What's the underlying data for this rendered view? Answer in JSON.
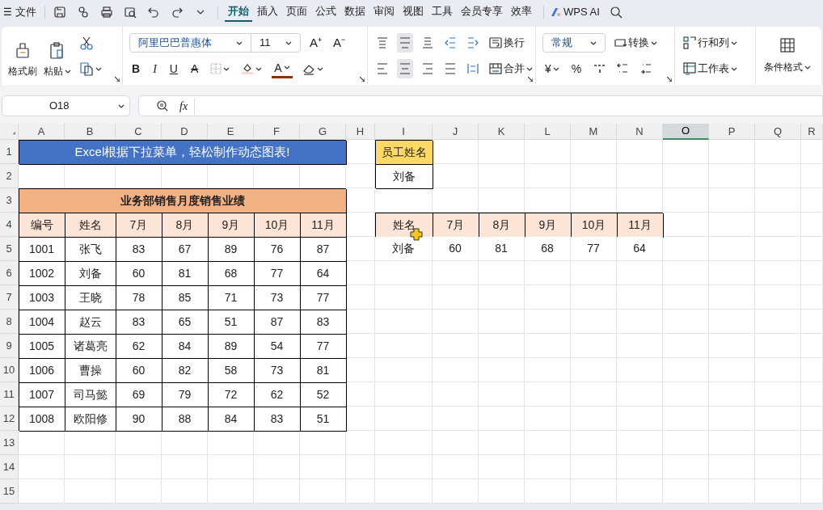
{
  "menu_bar": {
    "menu_glyph": "☰",
    "file": "文件",
    "tabs": [
      {
        "label": "开始",
        "selected": true
      },
      {
        "label": "插入",
        "selected": false
      },
      {
        "label": "页面",
        "selected": false
      },
      {
        "label": "公式",
        "selected": false
      },
      {
        "label": "数据",
        "selected": false
      },
      {
        "label": "审阅",
        "selected": false
      },
      {
        "label": "视图",
        "selected": false
      },
      {
        "label": "工具",
        "selected": false
      },
      {
        "label": "会员专享",
        "selected": false
      },
      {
        "label": "效率",
        "selected": false
      }
    ],
    "ai": "WPS AI"
  },
  "ribbon": {
    "format_painter": "格式刷",
    "paste": "粘贴",
    "font": "阿里巴巴普惠体",
    "size": "11",
    "grow": "A⁺",
    "shrink": "A⁻",
    "bold": "B",
    "italic": "I",
    "underline": "U",
    "strike": "A",
    "font_color": "A",
    "wrap": "换行",
    "merge": "合并",
    "number_format": "常规",
    "convert": "转换",
    "currency": "¥",
    "percent": "%",
    "rows_cols": "行和列",
    "worksheet": "工作表",
    "conditional": "条件格式"
  },
  "formula_bar": {
    "name_box": "O18",
    "fx": "fx"
  },
  "sheet": {
    "columns": [
      {
        "label": "A",
        "selected": false
      },
      {
        "label": "B",
        "selected": false
      },
      {
        "label": "C",
        "selected": false
      },
      {
        "label": "D",
        "selected": false
      },
      {
        "label": "E",
        "selected": false
      },
      {
        "label": "F",
        "selected": false
      },
      {
        "label": "G",
        "selected": false
      },
      {
        "label": "H",
        "selected": false
      },
      {
        "label": "I",
        "selected": false
      },
      {
        "label": "J",
        "selected": false
      },
      {
        "label": "K",
        "selected": false
      },
      {
        "label": "L",
        "selected": false
      },
      {
        "label": "M",
        "selected": false
      },
      {
        "label": "N",
        "selected": false
      },
      {
        "label": "O",
        "selected": true
      },
      {
        "label": "P",
        "selected": false
      },
      {
        "label": "Q",
        "selected": false
      },
      {
        "label": "R",
        "selected": false
      }
    ],
    "rows": [
      "1",
      "2",
      "3",
      "4",
      "5",
      "6",
      "7",
      "8",
      "9",
      "10",
      "11",
      "12",
      "13",
      "14",
      "15"
    ],
    "banner": "Excel根据下拉菜单，轻松制作动态图表!",
    "sales_table": {
      "title": "业务部销售月度销售业绩",
      "columns": [
        "编号",
        "姓名",
        "7月",
        "8月",
        "9月",
        "10月",
        "11月"
      ],
      "rows": [
        [
          "1001",
          "张飞",
          "83",
          "67",
          "89",
          "76",
          "87"
        ],
        [
          "1002",
          "刘备",
          "60",
          "81",
          "68",
          "77",
          "64"
        ],
        [
          "1003",
          "王晓",
          "78",
          "85",
          "71",
          "73",
          "77"
        ],
        [
          "1004",
          "赵云",
          "83",
          "65",
          "51",
          "87",
          "83"
        ],
        [
          "1005",
          "诸葛亮",
          "62",
          "84",
          "89",
          "54",
          "77"
        ],
        [
          "1006",
          "曹操",
          "60",
          "82",
          "58",
          "73",
          "81"
        ],
        [
          "1007",
          "司马懿",
          "69",
          "79",
          "72",
          "62",
          "52"
        ],
        [
          "1008",
          "欧阳修",
          "90",
          "88",
          "84",
          "83",
          "51"
        ]
      ]
    },
    "lookup": {
      "label": "员工姓名",
      "value": "刘备",
      "columns": [
        "姓名",
        "7月",
        "8月",
        "9月",
        "10月",
        "11月"
      ],
      "row": [
        "刘备",
        "60",
        "81",
        "68",
        "77",
        "64"
      ]
    }
  }
}
